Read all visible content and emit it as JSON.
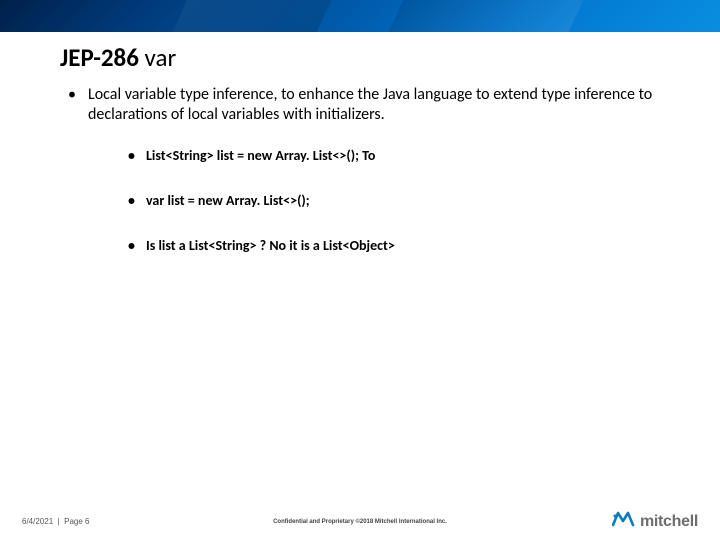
{
  "title": {
    "bold": "JEP-286",
    "rest": " var"
  },
  "bullets": {
    "main": "Local variable type inference, to enhance the Java language to extend type inference to declarations of local variables with initializers.",
    "sub": [
      "List<String> list = new Array. List<>(); To",
      "var list = new Array. List<>();",
      "Is list a List<String> ? No it is a List<Object>"
    ]
  },
  "footer": {
    "date": "6/4/2021",
    "page": "Page 6",
    "confidential": "Confidential and Proprietary ©2018 Mitchell International Inc.",
    "logo_text": "mitchell"
  }
}
